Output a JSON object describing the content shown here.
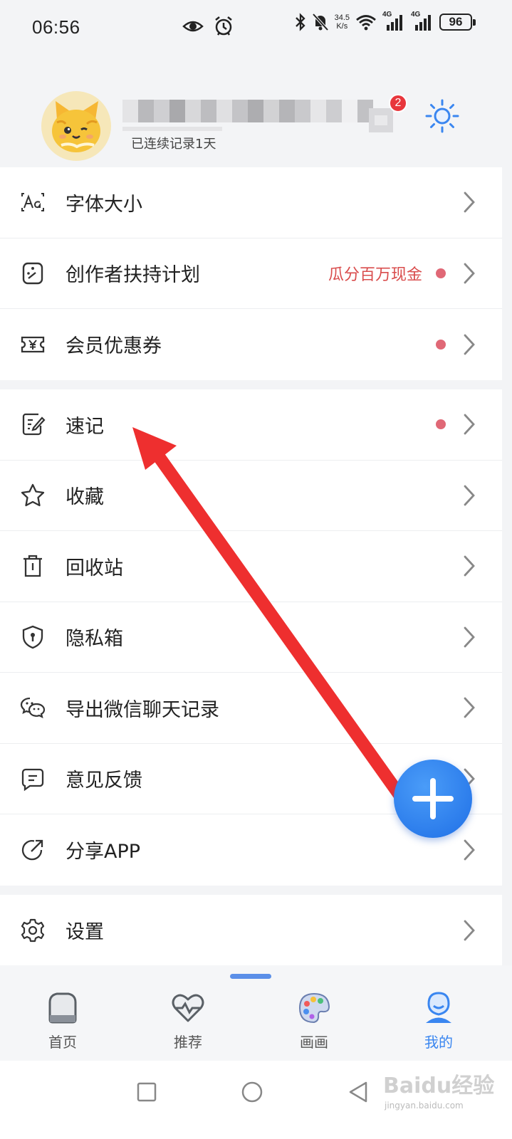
{
  "status_bar": {
    "time": "06:56",
    "net_speed_value": "34.5",
    "net_speed_unit": "K/s",
    "signal1_label": "4G",
    "signal2_label": "4G",
    "battery": "96"
  },
  "profile": {
    "streak": "已连续记录1天",
    "notification_count": "2"
  },
  "menu_group_1": [
    {
      "label": "字体大小",
      "icon": "font-size-icon",
      "extra": "",
      "dot": false
    },
    {
      "label": "创作者扶持计划",
      "icon": "creator-icon",
      "extra": "瓜分百万现金",
      "dot": true
    },
    {
      "label": "会员优惠券",
      "icon": "coupon-icon",
      "extra": "",
      "dot": true
    }
  ],
  "menu_group_2": [
    {
      "label": "速记",
      "icon": "quick-note-icon",
      "dot": true
    },
    {
      "label": "收藏",
      "icon": "star-icon",
      "dot": false
    },
    {
      "label": "回收站",
      "icon": "trash-icon",
      "dot": false
    },
    {
      "label": "隐私箱",
      "icon": "shield-lock-icon",
      "dot": false
    },
    {
      "label": "导出微信聊天记录",
      "icon": "wechat-icon",
      "dot": false
    },
    {
      "label": "意见反馈",
      "icon": "feedback-icon",
      "dot": false
    },
    {
      "label": "分享APP",
      "icon": "share-icon",
      "dot": false
    }
  ],
  "menu_group_3": [
    {
      "label": "设置",
      "icon": "gear-icon",
      "dot": false
    }
  ],
  "tabs": [
    {
      "label": "首页",
      "icon": "home-icon",
      "active": false
    },
    {
      "label": "推荐",
      "icon": "heart-pulse-icon",
      "active": false
    },
    {
      "label": "画画",
      "icon": "palette-icon",
      "active": false
    },
    {
      "label": "我的",
      "icon": "profile-icon",
      "active": true
    }
  ],
  "watermark": {
    "title": "Baidu经验",
    "url": "jingyan.baidu.com"
  },
  "colors": {
    "accent": "#3a86f0",
    "alert": "#d94c4c",
    "dot": "#e06876",
    "arrow": "#ee2f2f"
  }
}
